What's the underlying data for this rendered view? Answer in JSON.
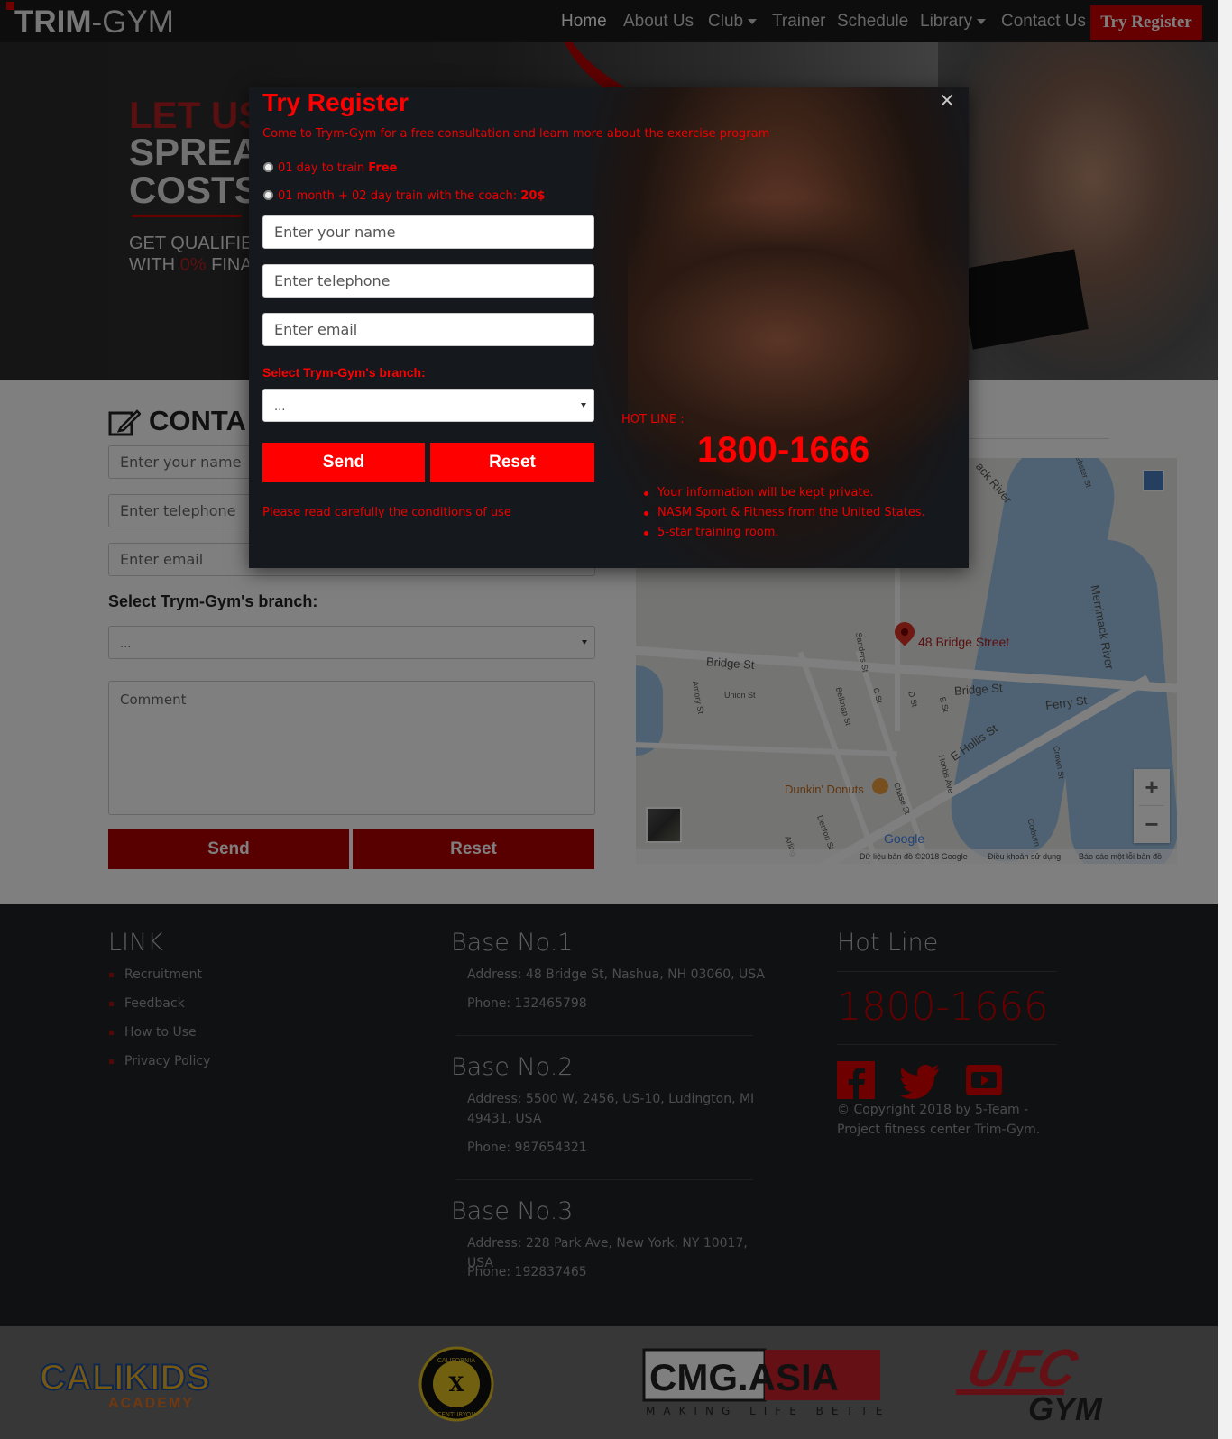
{
  "nav": {
    "logo_bold": "TRIM",
    "logo_rest": "-GYM",
    "items": [
      "Home",
      "About Us",
      "Club",
      "Trainer",
      "Schedule",
      "Library",
      "Contact Us"
    ],
    "try_register": "Try Register"
  },
  "hero": {
    "line1": "LET US",
    "line2": "SPREAI",
    "line3": "COSTS",
    "line4": "GET QUALIFIE",
    "line5_a": "WITH ",
    "line5_b": "0%",
    "line5_c": " FINAI"
  },
  "contact": {
    "title": "CONTA",
    "name_placeholder": "Enter your name",
    "phone_placeholder": "Enter telephone",
    "email_placeholder": "Enter email",
    "branch_label": "Select Trym-Gym's branch:",
    "branch_value": "...",
    "comment_placeholder": "Comment",
    "send": "Send",
    "reset": "Reset"
  },
  "map": {
    "pin_label": "48 Bridge Street",
    "labels": [
      "Bridge St",
      "Bridge St",
      "Ferry St",
      "E Hollis St",
      "Merrimack River",
      "Dunkin' Donuts",
      "Union St",
      "Amory St",
      "Sanders St",
      "Belknap St",
      "C St",
      "D St",
      "E St",
      "Hobbs Ave",
      "Chase St",
      "Denton St",
      "Crown St",
      "Colburn",
      "Arling",
      "ack River",
      "ebster St"
    ],
    "google": "Google",
    "footer": [
      "Dữ liệu bản đồ ©2018 Google",
      "Điều khoản sử dụng",
      "Báo cáo một lỗi bản đồ"
    ],
    "zoom_in": "+",
    "zoom_out": "−"
  },
  "footer": {
    "link_title": "LINK",
    "links": [
      "Recruitment",
      "Feedback",
      "How to Use",
      "Privacy Policy"
    ],
    "bases": [
      {
        "title": "Base No.1",
        "address": "Address: 48 Bridge St, Nashua, NH 03060, USA",
        "phone": "Phone: 132465798"
      },
      {
        "title": "Base No.2",
        "address": "Address: 5500 W, 2456, US-10, Ludington, MI 49431, USA",
        "phone": "Phone: 987654321"
      },
      {
        "title": "Base No.3",
        "address": "Address: 228 Park Ave, New York, NY 10017, USA",
        "phone": "Phone: 192837465"
      }
    ],
    "hotline_title": "Hot Line",
    "hotline_number": "1800-1666",
    "social_icons": [
      "facebook-icon",
      "twitter-icon",
      "youtube-icon"
    ],
    "copyright": "© Copyright 2018 by 5-Team - Project fitness center Trim-Gym."
  },
  "brands": [
    {
      "line1": "CALIKIDS",
      "line2": "ACADEMY"
    },
    {
      "line1": "CALIFORNIA",
      "line2": "CENTURYON"
    },
    {
      "line1": "CMG.ASIA",
      "line2": "MAKING LIFE BETTER"
    },
    {
      "line1": "UFC",
      "line2": "GYM"
    }
  ],
  "modal": {
    "title": "Try Register",
    "subtitle": "Come to Trym-Gym for a free consultation and learn more about the exercise program",
    "option1_text": "01 day to train ",
    "option1_bold": "Free",
    "option2_text": "01 month + 02 day train with the coach: ",
    "option2_bold": "20$",
    "name_placeholder": "Enter your name",
    "phone_placeholder": "Enter telephone",
    "email_placeholder": "Enter email",
    "branch_label": "Select Trym-Gym's branch:",
    "branch_value": "...",
    "send": "Send",
    "reset": "Reset",
    "conditions": "Please read carefully the conditions of use",
    "hotline_label": "HOT LINE :",
    "hotline_number": "1800-1666",
    "bullets": [
      "Your information will be kept private.",
      "NASM Sport & Fitness from the United States.",
      "5-star training room."
    ],
    "close": "×"
  },
  "colors": {
    "accent": "#ff0000",
    "dark_red": "#b00000",
    "footer_bg": "#1f2226",
    "nav_bg": "#1a1a1a"
  }
}
